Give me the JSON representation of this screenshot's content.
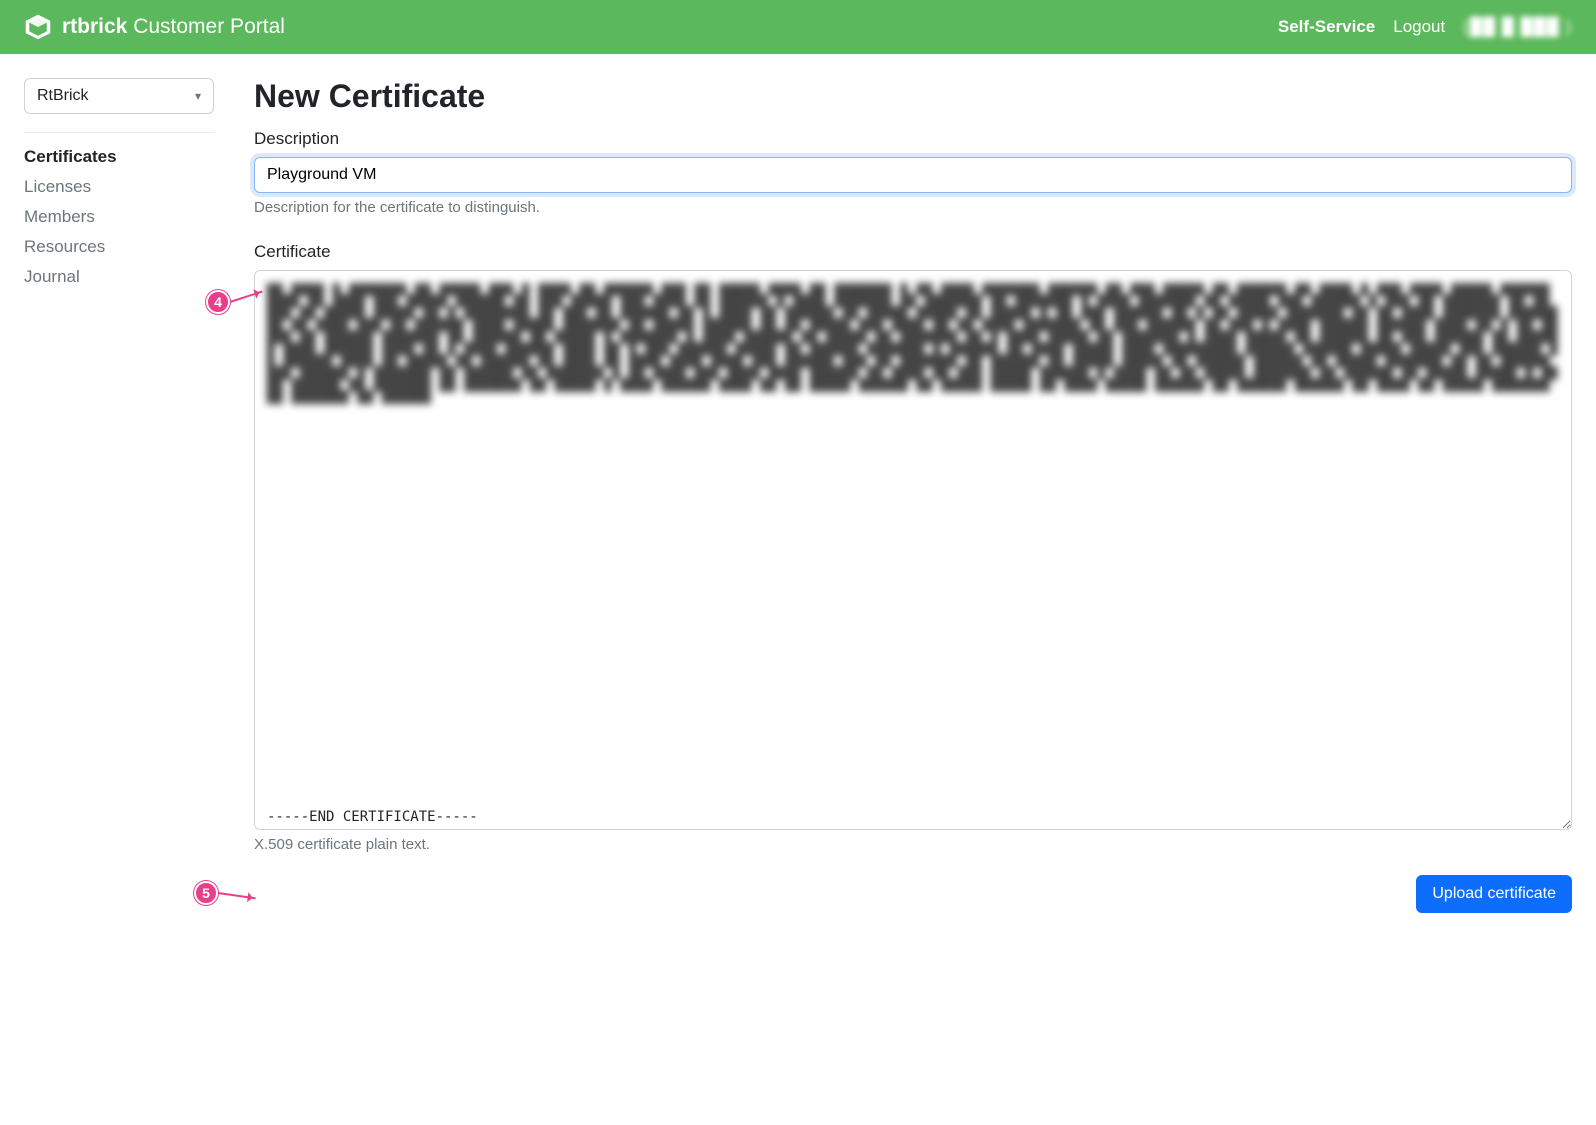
{
  "header": {
    "brand_bold": "rtbrick",
    "brand_sub": "Customer Portal",
    "self_service": "Self-Service",
    "logout": "Logout",
    "user_display": "(██ █ ███ )"
  },
  "sidebar": {
    "org_selected": "RtBrick",
    "items": [
      {
        "label": "Certificates",
        "active": true
      },
      {
        "label": "Licenses",
        "active": false
      },
      {
        "label": "Members",
        "active": false
      },
      {
        "label": "Resources",
        "active": false
      },
      {
        "label": "Journal",
        "active": false
      }
    ]
  },
  "page": {
    "title": "New Certificate",
    "description_label": "Description",
    "description_value": "Playground VM",
    "description_help": "Description for the certificate to distinguish.",
    "certificate_label": "Certificate",
    "certificate_end_line": "-----END CERTIFICATE-----",
    "certificate_help": "X.509 certificate plain text.",
    "upload_button": "Upload certificate"
  },
  "annotations": {
    "num4": "4",
    "num5": "5"
  }
}
